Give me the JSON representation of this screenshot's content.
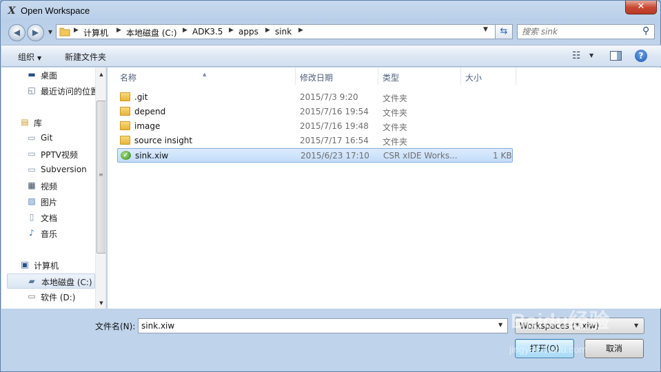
{
  "window": {
    "title": "Open Workspace",
    "app_icon_glyph": "X",
    "close_glyph": "✕"
  },
  "address": {
    "crumbs": [
      "计算机",
      "本地磁盘 (C:)",
      "ADK3.5",
      "apps",
      "sink"
    ],
    "search_placeholder": "搜索 sink"
  },
  "toolbar": {
    "organize_label": "组织",
    "new_folder_label": "新建文件夹"
  },
  "nav": {
    "items": [
      {
        "label": "桌面",
        "icon": "desktop-icon",
        "glyph": "▬"
      },
      {
        "label": "最近访问的位置",
        "icon": "recent-places-icon",
        "glyph": "◱"
      },
      {
        "label": "库",
        "icon": "library-icon",
        "glyph": "▤"
      },
      {
        "label": "Git",
        "icon": "library-doc-icon",
        "glyph": "▭"
      },
      {
        "label": "PPTV视频",
        "icon": "library-doc-icon",
        "glyph": "▭"
      },
      {
        "label": "Subversion",
        "icon": "library-doc-icon",
        "glyph": "▭"
      },
      {
        "label": "视频",
        "icon": "video-icon",
        "glyph": "▦"
      },
      {
        "label": "图片",
        "icon": "picture-icon",
        "glyph": "▨"
      },
      {
        "label": "文档",
        "icon": "document-icon",
        "glyph": "▯"
      },
      {
        "label": "音乐",
        "icon": "music-icon",
        "glyph": "♪"
      },
      {
        "label": "计算机",
        "icon": "computer-icon",
        "glyph": "▣"
      },
      {
        "label": "本地磁盘 (C:)",
        "icon": "local-disk-icon",
        "glyph": "▰"
      },
      {
        "label": "软件 (D:)",
        "icon": "drive-icon",
        "glyph": "▭"
      }
    ]
  },
  "files": {
    "headers": {
      "name": "名称",
      "date": "修改日期",
      "type": "类型",
      "size": "大小"
    },
    "rows": [
      {
        "name": ".git",
        "date": "2015/7/3 9:20",
        "type": "文件夹",
        "size": "",
        "kind": "folder"
      },
      {
        "name": "depend",
        "date": "2015/7/16 19:54",
        "type": "文件夹",
        "size": "",
        "kind": "folder"
      },
      {
        "name": "image",
        "date": "2015/7/16 19:48",
        "type": "文件夹",
        "size": "",
        "kind": "folder"
      },
      {
        "name": "source insight",
        "date": "2015/7/17 16:54",
        "type": "文件夹",
        "size": "",
        "kind": "folder"
      },
      {
        "name": "sink.xiw",
        "date": "2015/6/23 17:10",
        "type": "CSR xIDE Works...",
        "size": "1 KB",
        "kind": "xiw"
      }
    ]
  },
  "bottom": {
    "filename_label": "文件名(N):",
    "filename_value": "sink.xiw",
    "filter_value": "Workspaces (*.xiw)",
    "open_label": "打开(O)",
    "cancel_label": "取消"
  },
  "watermark": {
    "main": "Baidu经验",
    "sub": "jingyan.baidu.com"
  }
}
